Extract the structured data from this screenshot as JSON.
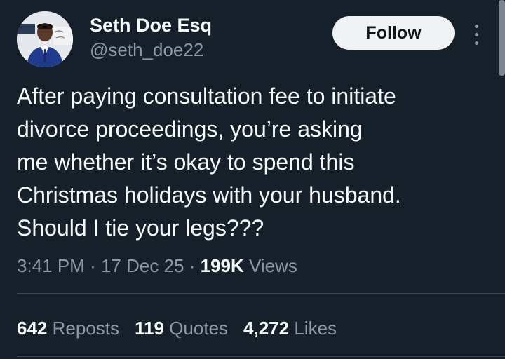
{
  "author": {
    "display_name": "Seth Doe Esq",
    "handle": "@seth_doe22",
    "avatar_icon": "profile-photo"
  },
  "actions": {
    "follow_label": "Follow",
    "more_icon": "vertical-ellipsis-icon"
  },
  "tweet": {
    "lines": [
      "After paying consultation fee to initiate",
      "divorce proceedings, you’re asking",
      "me whether it’s okay to spend this",
      "Christmas holidays with your husband.",
      "Should I tie your legs???"
    ]
  },
  "meta": {
    "time": "3:41 PM",
    "separator": "·",
    "date": "17 Dec 25",
    "views_count": "199K",
    "views_label": "Views"
  },
  "stats": {
    "reposts_count": "642",
    "reposts_label": "Reposts",
    "quotes_count": "119",
    "quotes_label": "Quotes",
    "likes_count": "4,272",
    "likes_label": "Likes"
  },
  "colors": {
    "background": "#15202b",
    "primary_text": "#f7f9f9",
    "secondary_text": "#8b98a5",
    "button_bg": "#eff3f4"
  }
}
